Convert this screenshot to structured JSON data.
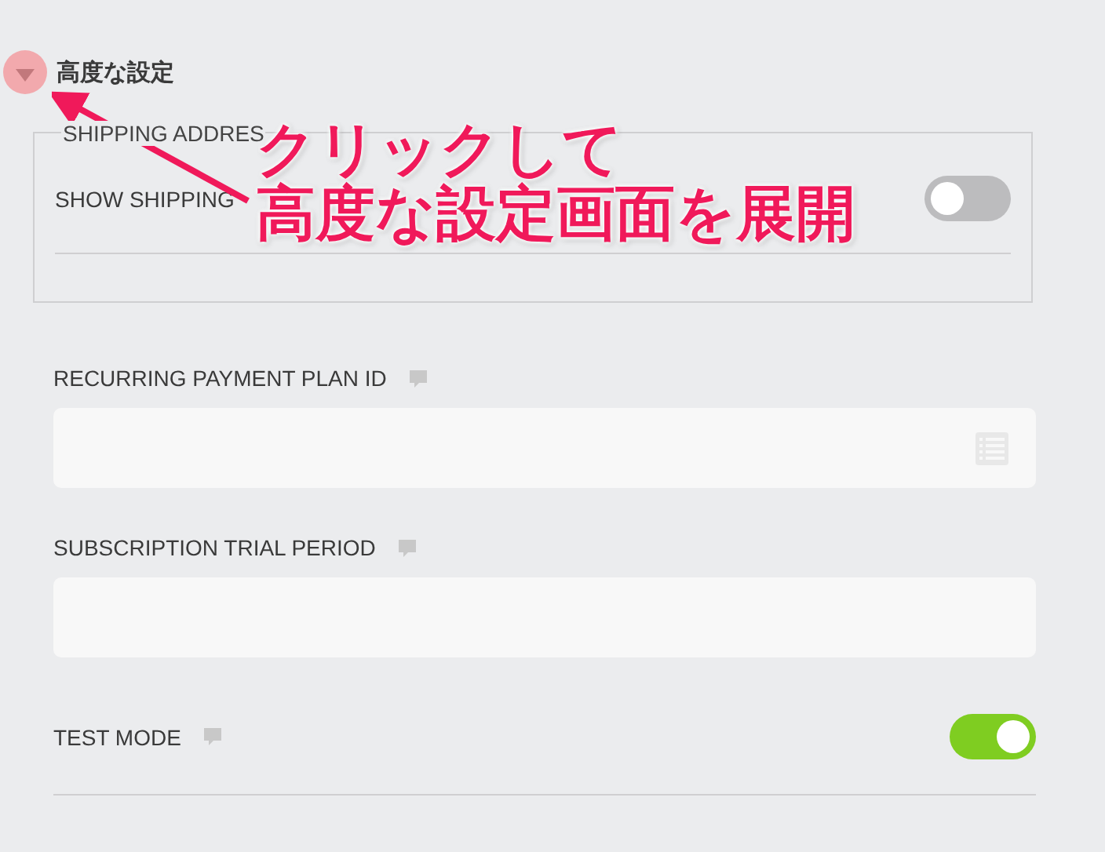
{
  "section": {
    "title": "高度な設定",
    "expanded": true,
    "group": {
      "legend": "SHIPPING ADDRES",
      "rows": [
        {
          "label": "SHOW SHIPPING",
          "on": false
        }
      ]
    }
  },
  "fields": [
    {
      "kind": "input",
      "label": "RECURRING PAYMENT PLAN ID",
      "has_list_icon": true
    },
    {
      "kind": "input",
      "label": "SUBSCRIPTION TRIAL PERIOD",
      "has_list_icon": false
    },
    {
      "kind": "toggle",
      "label": "TEST MODE",
      "on": true
    }
  ],
  "annotation": {
    "lines": [
      "クリックして",
      "高度な設定画面を展開"
    ]
  }
}
